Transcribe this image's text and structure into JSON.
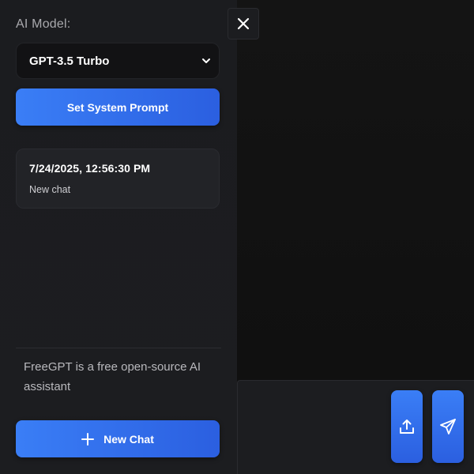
{
  "sidebar": {
    "model_label": "AI Model:",
    "model_select": {
      "selected": "GPT-3.5 Turbo",
      "icon": "chevron-down-icon"
    },
    "system_prompt_button": "Set System Prompt",
    "chats": [
      {
        "date": "7/24/2025, 12:56:30 PM",
        "title": "New chat"
      }
    ],
    "about": "FreeGPT is a free open-source AI assistant",
    "new_chat_button": {
      "label": "New Chat",
      "icon": "plus-icon"
    }
  },
  "header": {
    "close_icon": "close-icon"
  },
  "composer": {
    "upload_icon": "upload-icon",
    "send_icon": "send-icon"
  },
  "colors": {
    "accent": "#3a7ef6",
    "accent_dark": "#2b5fe0",
    "background": "#121212",
    "sidebar": "#1c1d20"
  }
}
